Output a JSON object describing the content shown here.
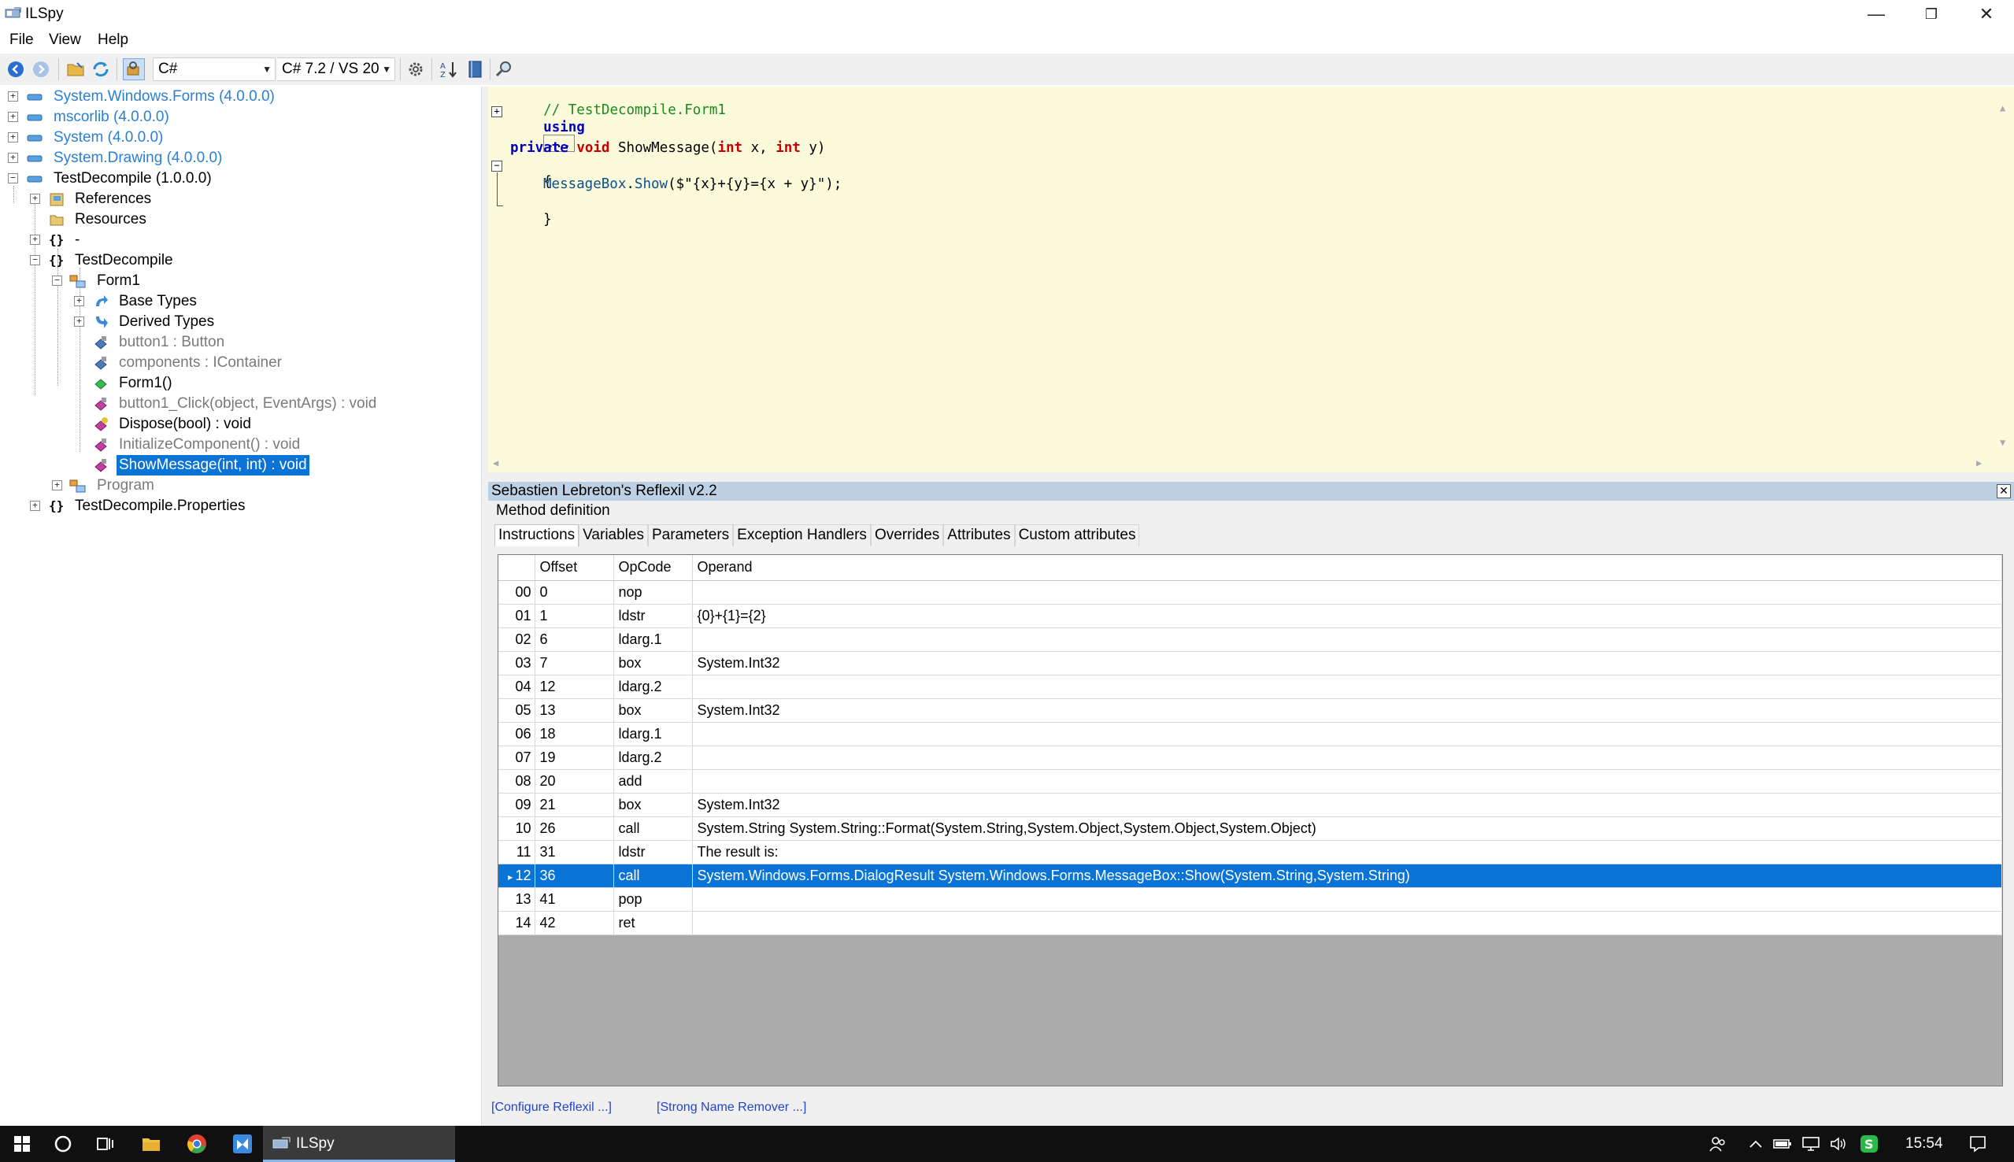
{
  "window": {
    "title": "ILSpy",
    "minimize_glyph": "—",
    "restore_glyph": "❐",
    "close_glyph": "✕"
  },
  "menu": [
    "File",
    "View",
    "Help"
  ],
  "toolbar": {
    "language": "C#",
    "version": "C# 7.2 / VS 20"
  },
  "tree": {
    "assemblies": [
      {
        "label": "System.Windows.Forms (4.0.0.0)"
      },
      {
        "label": "mscorlib (4.0.0.0)"
      },
      {
        "label": "System (4.0.0.0)"
      },
      {
        "label": "System.Drawing (4.0.0.0)"
      },
      {
        "label": "TestDecompile (1.0.0.0)"
      }
    ],
    "references": "References",
    "resources": "Resources",
    "ns_dash": "-",
    "ns_testdecompile": "TestDecompile",
    "form1": "Form1",
    "base_types": "Base Types",
    "derived_types": "Derived Types",
    "members": [
      {
        "label": "button1 : Button"
      },
      {
        "label": "components : IContainer"
      },
      {
        "label": "Form1()"
      },
      {
        "label": "button1_Click(object, EventArgs) : void"
      },
      {
        "label": "Dispose(bool) : void"
      },
      {
        "label": "InitializeComponent() : void"
      },
      {
        "label": "ShowMessage(int, int) : void"
      }
    ],
    "program": "Program",
    "ns_properties": "TestDecompile.Properties"
  },
  "editor": {
    "comment": "// TestDecompile.Form1",
    "using_kw": "using",
    "using_ellipsis": "...",
    "private_kw": "private",
    "void_kw": "void",
    "method_name": "ShowMessage",
    "open_paren": "(",
    "int_kw": "int",
    "param_x": " x, ",
    "param_y": " y)",
    "open_brace": "{",
    "call_ident": "MessageBox",
    "call_dot": ".",
    "call_method": "Show",
    "call_args": "($\"{x}+{y}={x + y}\");",
    "close_brace": "}"
  },
  "reflexil": {
    "header": "Sebastien Lebreton's Reflexil v2.2",
    "close_glyph": "✕",
    "method_definition": "Method definition",
    "tabs": [
      "Instructions",
      "Variables",
      "Parameters",
      "Exception Handlers",
      "Overrides",
      "Attributes",
      "Custom attributes"
    ],
    "columns": [
      "Offset",
      "OpCode",
      "Operand"
    ],
    "rows": [
      {
        "idx": "00",
        "offset": "0",
        "opcode": "nop",
        "operand": ""
      },
      {
        "idx": "01",
        "offset": "1",
        "opcode": "ldstr",
        "operand": "{0}+{1}={2}"
      },
      {
        "idx": "02",
        "offset": "6",
        "opcode": "ldarg.1",
        "operand": ""
      },
      {
        "idx": "03",
        "offset": "7",
        "opcode": "box",
        "operand": "System.Int32"
      },
      {
        "idx": "04",
        "offset": "12",
        "opcode": "ldarg.2",
        "operand": ""
      },
      {
        "idx": "05",
        "offset": "13",
        "opcode": "box",
        "operand": "System.Int32"
      },
      {
        "idx": "06",
        "offset": "18",
        "opcode": "ldarg.1",
        "operand": ""
      },
      {
        "idx": "07",
        "offset": "19",
        "opcode": "ldarg.2",
        "operand": ""
      },
      {
        "idx": "08",
        "offset": "20",
        "opcode": "add",
        "operand": ""
      },
      {
        "idx": "09",
        "offset": "21",
        "opcode": "box",
        "operand": "System.Int32"
      },
      {
        "idx": "10",
        "offset": "26",
        "opcode": "call",
        "operand": "System.String System.String::Format(System.String,System.Object,System.Object,System.Object)"
      },
      {
        "idx": "11",
        "offset": "31",
        "opcode": "ldstr",
        "operand": "The result is:"
      },
      {
        "idx": "12",
        "offset": "36",
        "opcode": "call",
        "operand": "System.Windows.Forms.DialogResult System.Windows.Forms.MessageBox::Show(System.String,System.String)",
        "selected": true
      },
      {
        "idx": "13",
        "offset": "41",
        "opcode": "pop",
        "operand": ""
      },
      {
        "idx": "14",
        "offset": "42",
        "opcode": "ret",
        "operand": ""
      }
    ],
    "link_configure": "[Configure Reflexil ...]",
    "link_strongname": "[Strong Name Remover ...]"
  },
  "taskbar": {
    "active_app": "ILSpy",
    "clock": "15:54"
  },
  "colors": {
    "selection": "#0a74d6",
    "editor_bg": "#fbfbdc",
    "assembly_link": "#2a7fd6",
    "keyword": "#0000c8",
    "type_keyword": "#c80000",
    "comment": "#1a8a1a"
  }
}
